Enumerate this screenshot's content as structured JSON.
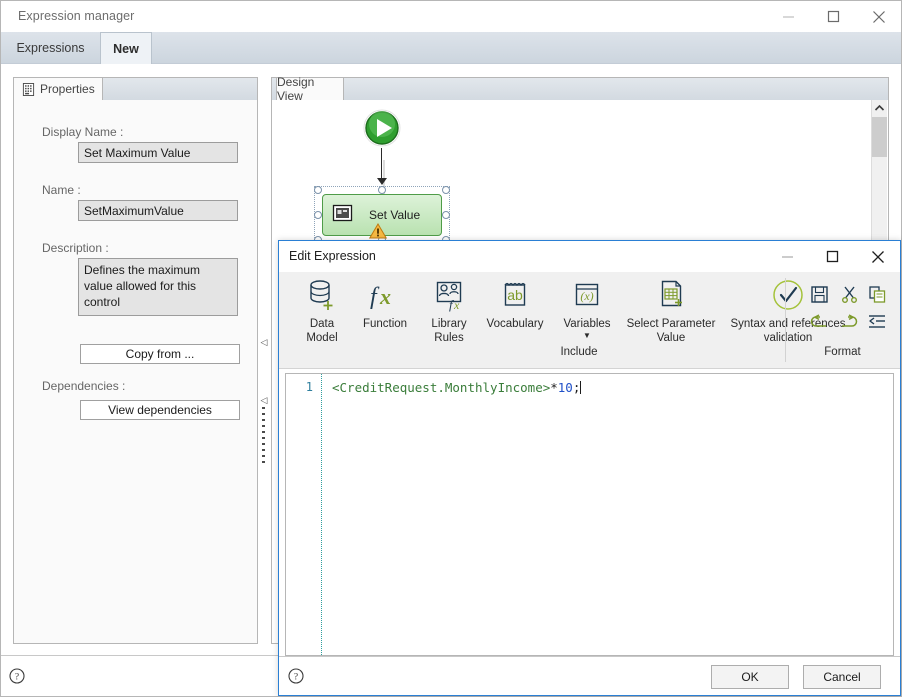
{
  "main_window": {
    "title": "Expression manager",
    "controls": {
      "minimize": "minimize-icon",
      "maximize": "maximize-icon",
      "close": "close-icon"
    }
  },
  "tabs": [
    {
      "label": "Expressions",
      "active": false
    },
    {
      "label": "New",
      "active": true
    }
  ],
  "properties_panel": {
    "tab_label": "Properties",
    "tab_icon": "properties-icon",
    "fields": [
      {
        "label": "Display Name :",
        "value": "Set Maximum Value"
      },
      {
        "label": "Name :",
        "value": "SetMaximumValue"
      },
      {
        "label": "Description :",
        "value": "Defines the maximum value allowed for this control"
      }
    ],
    "copy_from_button": "Copy from ...",
    "dependencies_label": "Dependencies :",
    "view_dependencies_button": "View dependencies"
  },
  "design_view": {
    "tab_label": "Design View",
    "nodes": [
      {
        "type": "start",
        "icon": "play-start-icon"
      },
      {
        "type": "activity",
        "label": "Set Value",
        "icon": "set-value-icon",
        "badge": "warning-icon",
        "selected": true
      }
    ]
  },
  "dialog": {
    "title": "Edit Expression",
    "controls": {
      "minimize": "minimize-icon",
      "maximize": "maximize-icon",
      "close": "close-icon"
    },
    "ribbon": {
      "buttons": [
        {
          "id": "data-model",
          "line1": "Data",
          "line2": "Model",
          "icon": "database-add-icon"
        },
        {
          "id": "function",
          "line1": "Function",
          "line2": "",
          "icon": "fx-icon"
        },
        {
          "id": "library-rules",
          "line1": "Library",
          "line2": "Rules",
          "icon": "library-rules-icon"
        },
        {
          "id": "vocabulary",
          "line1": "Vocabulary",
          "line2": "",
          "icon": "vocabulary-ab-icon"
        },
        {
          "id": "variables",
          "line1": "Variables",
          "line2": "",
          "icon": "variables-x-icon",
          "has_caret": true
        },
        {
          "id": "select-parameter-value",
          "line1": "Select Parameter",
          "line2": "Value",
          "icon": "parameter-table-add-icon"
        },
        {
          "id": "syntax-validation",
          "line1": "Syntax and references",
          "line2": "validation",
          "icon": "check-circle-icon"
        }
      ],
      "include_group_label": "Include",
      "format_group_label": "Format",
      "format_icons": [
        "save-icon",
        "cut-scissors-icon",
        "copy-icon",
        "undo-icon",
        "redo-icon",
        "outdent-icon"
      ]
    },
    "editor": {
      "line_number": "1",
      "expression_tokens": [
        {
          "text": "<CreditRequest.MonthlyIncome>",
          "type": "tag"
        },
        {
          "text": "*",
          "type": "operator"
        },
        {
          "text": "10",
          "type": "number"
        },
        {
          "text": ";",
          "type": "punctuation"
        }
      ],
      "expression_plain": "<CreditRequest.MonthlyIncome>*10;"
    },
    "footer": {
      "help_icon": "help-circle-icon",
      "ok_button": "OK",
      "cancel_button": "Cancel"
    }
  },
  "status_bar": {
    "help_icon": "help-circle-icon"
  },
  "colors": {
    "accent_blue": "#2a7fd4",
    "tab_strip": "#d6dde5",
    "node_green_fill": "#b9e2b0",
    "node_green_border": "#4f9c48",
    "ribbon_olive": "#7d9a2b",
    "code_tag_green": "#3a7d3a",
    "code_number_blue": "#2050c8",
    "line_number_teal": "#2f7f9e"
  }
}
